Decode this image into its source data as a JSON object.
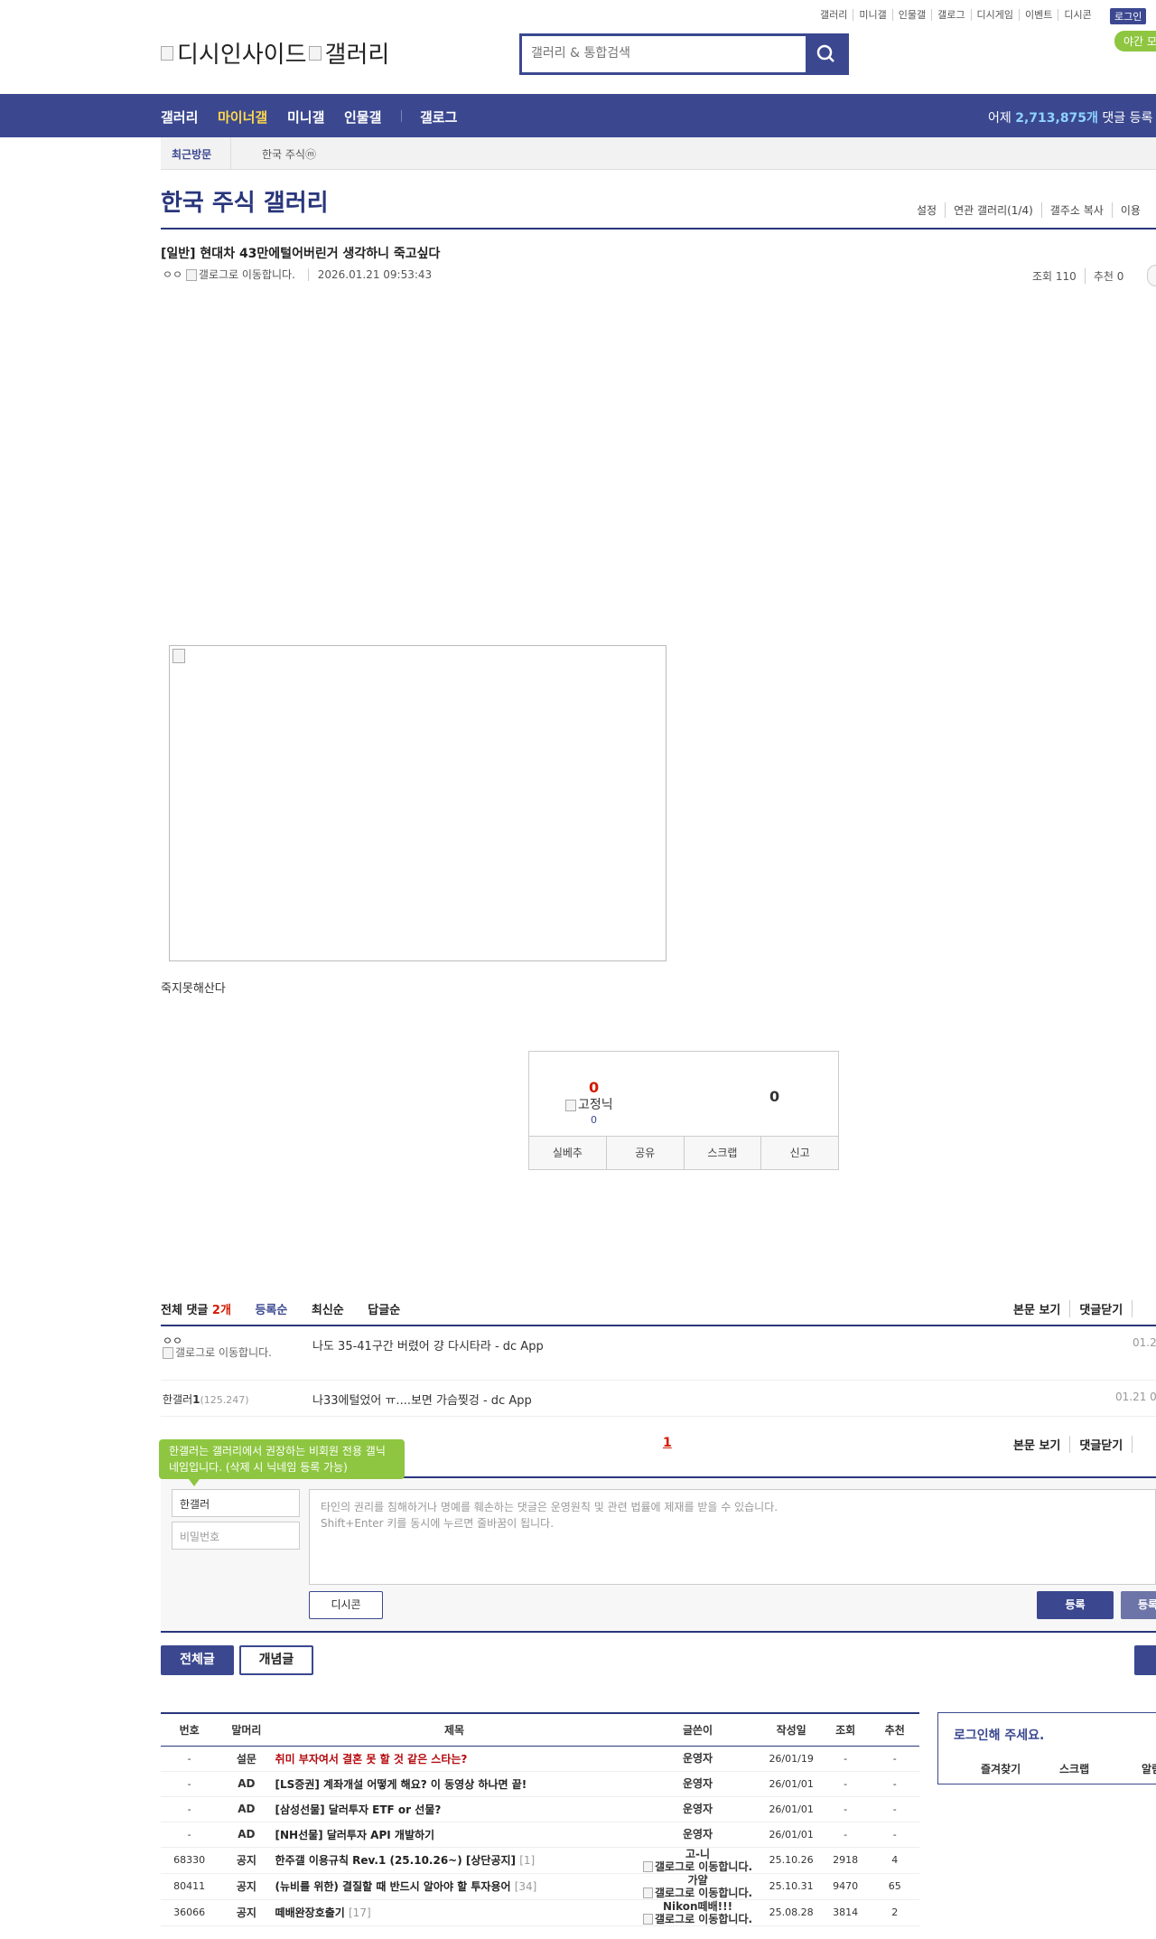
{
  "top_menu": [
    "갤러리",
    "미니갤",
    "인물갤",
    "갤로그",
    "디시게임",
    "이벤트",
    "디시콘"
  ],
  "login_label": "로그인",
  "night_mode_label": "야간 모",
  "logo_alt_1": "디시인사이드",
  "logo_alt_2": "갤러리",
  "search_placeholder": "갤러리 & 통합검색",
  "gnb": {
    "items": [
      "갤러리",
      "마이너갤",
      "미니갤",
      "인물갤",
      "갤로그"
    ],
    "stat_prefix": "어제",
    "stat_value": "2,713,875개",
    "stat_suffix": "댓글 등록"
  },
  "recent": {
    "label": "최근방문",
    "gallery": "한국 주식ⓜ"
  },
  "gallery": {
    "title": "한국 주식 갤러리",
    "tools": [
      "설정",
      "연관 갤러리(1/4)",
      "갤주소 복사",
      "이용"
    ]
  },
  "post": {
    "title": "[일반] 현대차 43만에털어버린거 생각하니 죽고싶다",
    "author": "ㅇㅇ",
    "author_icon_alt": "갤로그로 이동합니다.",
    "date": "2026.01.21 09:53:43",
    "views": "조회 110",
    "recommends": "추천 0",
    "text": "죽지못해산다"
  },
  "vote": {
    "up": "0",
    "fixed_label": "고정닉",
    "fixed_count": "0",
    "down": "0",
    "buttons": [
      "실베추",
      "공유",
      "스크랩",
      "신고"
    ]
  },
  "comments": {
    "total_label": "전체 댓글",
    "total_count": "2개",
    "sorts": [
      "등록순",
      "최신순",
      "답글순"
    ],
    "tools": [
      "본문 보기",
      "댓글닫기"
    ],
    "items": [
      {
        "name": "ㅇㅇ",
        "name_icon": "갤로그로 이동합니다.",
        "text": "나도 35-41구간 버렸어 걍 다시타라 - dc App",
        "date": "01.2"
      },
      {
        "name": "한갤러",
        "name_num": "1",
        "ip": "(125.247)",
        "text": "나33에털었어 ㅠ....보면 가슴찢겅 - dc App",
        "date": "01.21 09"
      }
    ],
    "page": "1"
  },
  "comment_form": {
    "tooltip": "한갤러는 갤러리에서 권장하는 비회원 전용 갤닉네임입니다. (삭제 시 닉네임 등록 가능)",
    "nickname": "한갤러",
    "password_placeholder": "비밀번호",
    "textarea_line1": "타인의 권리를 침해하거나 명예를 훼손하는 댓글은 운영원칙 및 관련 법률에 제재를 받을 수 있습니다.",
    "textarea_line2": "Shift+Enter 키를 동시에 누르면 줄바꿈이 됩니다.",
    "dccon": "디시콘",
    "submit": "등록",
    "submit2": "등록"
  },
  "list_buttons": {
    "all": "전체글",
    "concept": "개념글"
  },
  "board": {
    "headers": [
      "번호",
      "말머리",
      "제목",
      "글쓴이",
      "작성일",
      "조회",
      "추천"
    ],
    "rows": [
      {
        "no": "-",
        "head": "설문",
        "subject": "취미 부자여서 결혼 못 할 것 같은 스타는?",
        "reply": "",
        "writer": "운영자",
        "writer_icon": "",
        "date": "26/01/19",
        "views": "-",
        "rec": "-",
        "red": true
      },
      {
        "no": "-",
        "head": "AD",
        "subject": "[LS증권] 계좌개설 어떻게 해요? 이 동영상 하나면 끝!",
        "reply": "",
        "writer": "운영자",
        "writer_icon": "",
        "date": "26/01/01",
        "views": "-",
        "rec": "-",
        "red": false
      },
      {
        "no": "-",
        "head": "AD",
        "subject": "[삼성선물] 달러투자 ETF or 선물?",
        "reply": "",
        "writer": "운영자",
        "writer_icon": "",
        "date": "26/01/01",
        "views": "-",
        "rec": "-",
        "red": false
      },
      {
        "no": "-",
        "head": "AD",
        "subject": "[NH선물] 달러투자 API 개발하기",
        "reply": "",
        "writer": "운영자",
        "writer_icon": "",
        "date": "26/01/01",
        "views": "-",
        "rec": "-",
        "red": false
      },
      {
        "no": "68330",
        "head": "공지",
        "subject": "한주갤 이용규칙 Rev.1 (25.10.26~) [상단공지]",
        "reply": "[1]",
        "writer": "고-니",
        "writer_icon": "갤로그로 이동합니다.",
        "date": "25.10.26",
        "views": "2918",
        "rec": "4",
        "red": false
      },
      {
        "no": "80411",
        "head": "공지",
        "subject": "(뉴비를 위한) 결질할 때 반드시 알아야 할 투자용어",
        "reply": "[34]",
        "writer": "가얄",
        "writer_icon": "갤로그로 이동합니다.",
        "date": "25.10.31",
        "views": "9470",
        "rec": "65",
        "red": false
      },
      {
        "no": "36066",
        "head": "공지",
        "subject": "떼배완장호출기",
        "reply": "[17]",
        "writer": "Nikon떼배!!!",
        "writer_icon": "갤로그로 이동합니다.",
        "date": "25.08.28",
        "views": "3814",
        "rec": "2",
        "red": false
      }
    ]
  },
  "login_box": {
    "title": "로그인해 주세요.",
    "links": [
      "즐겨찾기",
      "스크랩",
      "알림"
    ]
  }
}
